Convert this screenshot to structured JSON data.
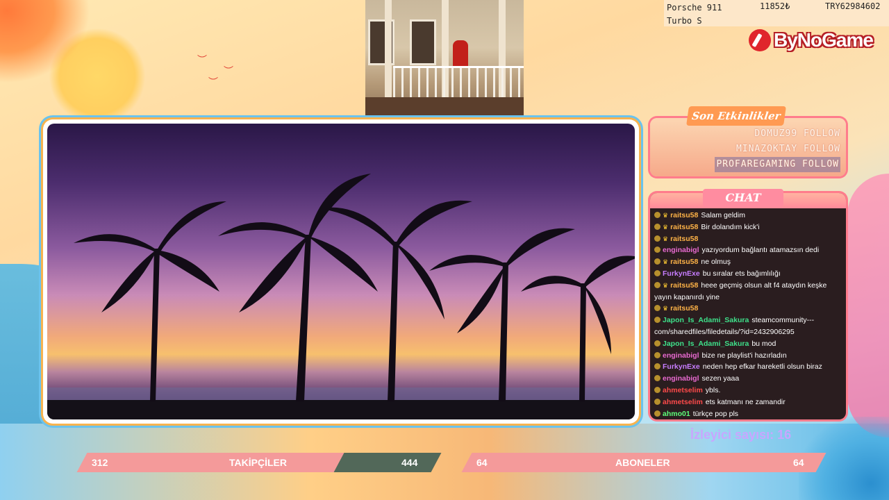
{
  "ticker": {
    "product_line1": "Porsche 911",
    "product_line2": "Turbo S",
    "price": "11852₺",
    "code": "TRY62984602"
  },
  "logo": {
    "text": "ByNoGame",
    "brand_color": "#e0252c"
  },
  "events": {
    "title": "Son Etkinlikler",
    "items": [
      {
        "label": "DOMUZ99 FOLLOW"
      },
      {
        "label": "MINAZOKTAY FOLLOW"
      },
      {
        "label": "PROFAREGAMING FOLLOW"
      }
    ]
  },
  "chat": {
    "title": "CHAT",
    "messages": [
      {
        "user": "raitsu58",
        "color": "#ffb347",
        "text": "Salam geldim",
        "crown": true
      },
      {
        "user": "raitsu58",
        "color": "#ffb347",
        "text": "Bir dolandım kick'i",
        "crown": true
      },
      {
        "user": "raitsu58",
        "color": "#ffb347",
        "text": "",
        "crown": true
      },
      {
        "user": "enginabigl",
        "color": "#e86ad0",
        "text": "yazıyordum bağlantı atamazsın dedi",
        "crown": false
      },
      {
        "user": "raitsu58",
        "color": "#ffb347",
        "text": "ne olmuş",
        "crown": true
      },
      {
        "user": "FurkynExe",
        "color": "#c77dff",
        "text": "bu sıralar ets bağımlılığı",
        "crown": false
      },
      {
        "user": "raitsu58",
        "color": "#ffb347",
        "text": "heee geçmiş olsun alt f4 ataydın keşke yayın kapanırdı yine",
        "crown": true
      },
      {
        "user": "raitsu58",
        "color": "#ffb347",
        "text": "",
        "crown": true
      },
      {
        "user": "Japon_Is_Adami_Sakura",
        "color": "#3ee08a",
        "text": "steamcommunity---com/sharedfiles/filedetails/?id=2432906295",
        "crown": false
      },
      {
        "user": "Japon_Is_Adami_Sakura",
        "color": "#3ee08a",
        "text": "bu mod",
        "crown": false
      },
      {
        "user": "enginabigl",
        "color": "#e86ad0",
        "text": "bize ne playlist'i hazırladın",
        "crown": false
      },
      {
        "user": "FurkynExe",
        "color": "#c77dff",
        "text": "neden hep efkar hareketli olsun biraz",
        "crown": false
      },
      {
        "user": "enginabigl",
        "color": "#e86ad0",
        "text": "sezen yaaa",
        "crown": false
      },
      {
        "user": "ahmetselim",
        "color": "#ff4a4a",
        "text": "ybls.",
        "crown": false
      },
      {
        "user": "ahmetselim",
        "color": "#ff4a4a",
        "text": "ets katmanı ne zamandir",
        "crown": false
      },
      {
        "user": "ahmo01",
        "color": "#5dff7a",
        "text": "türkçe pop pls",
        "crown": false
      }
    ]
  },
  "viewer": {
    "label": "İzleyici sayısı: 16"
  },
  "bottom": {
    "followers": {
      "left": "312",
      "label": "TAKİPÇİLER",
      "right": "444",
      "progress": 0.7
    },
    "subscribers": {
      "left": "64",
      "label": "ABONELER",
      "right": "64",
      "progress": 1.0
    }
  }
}
